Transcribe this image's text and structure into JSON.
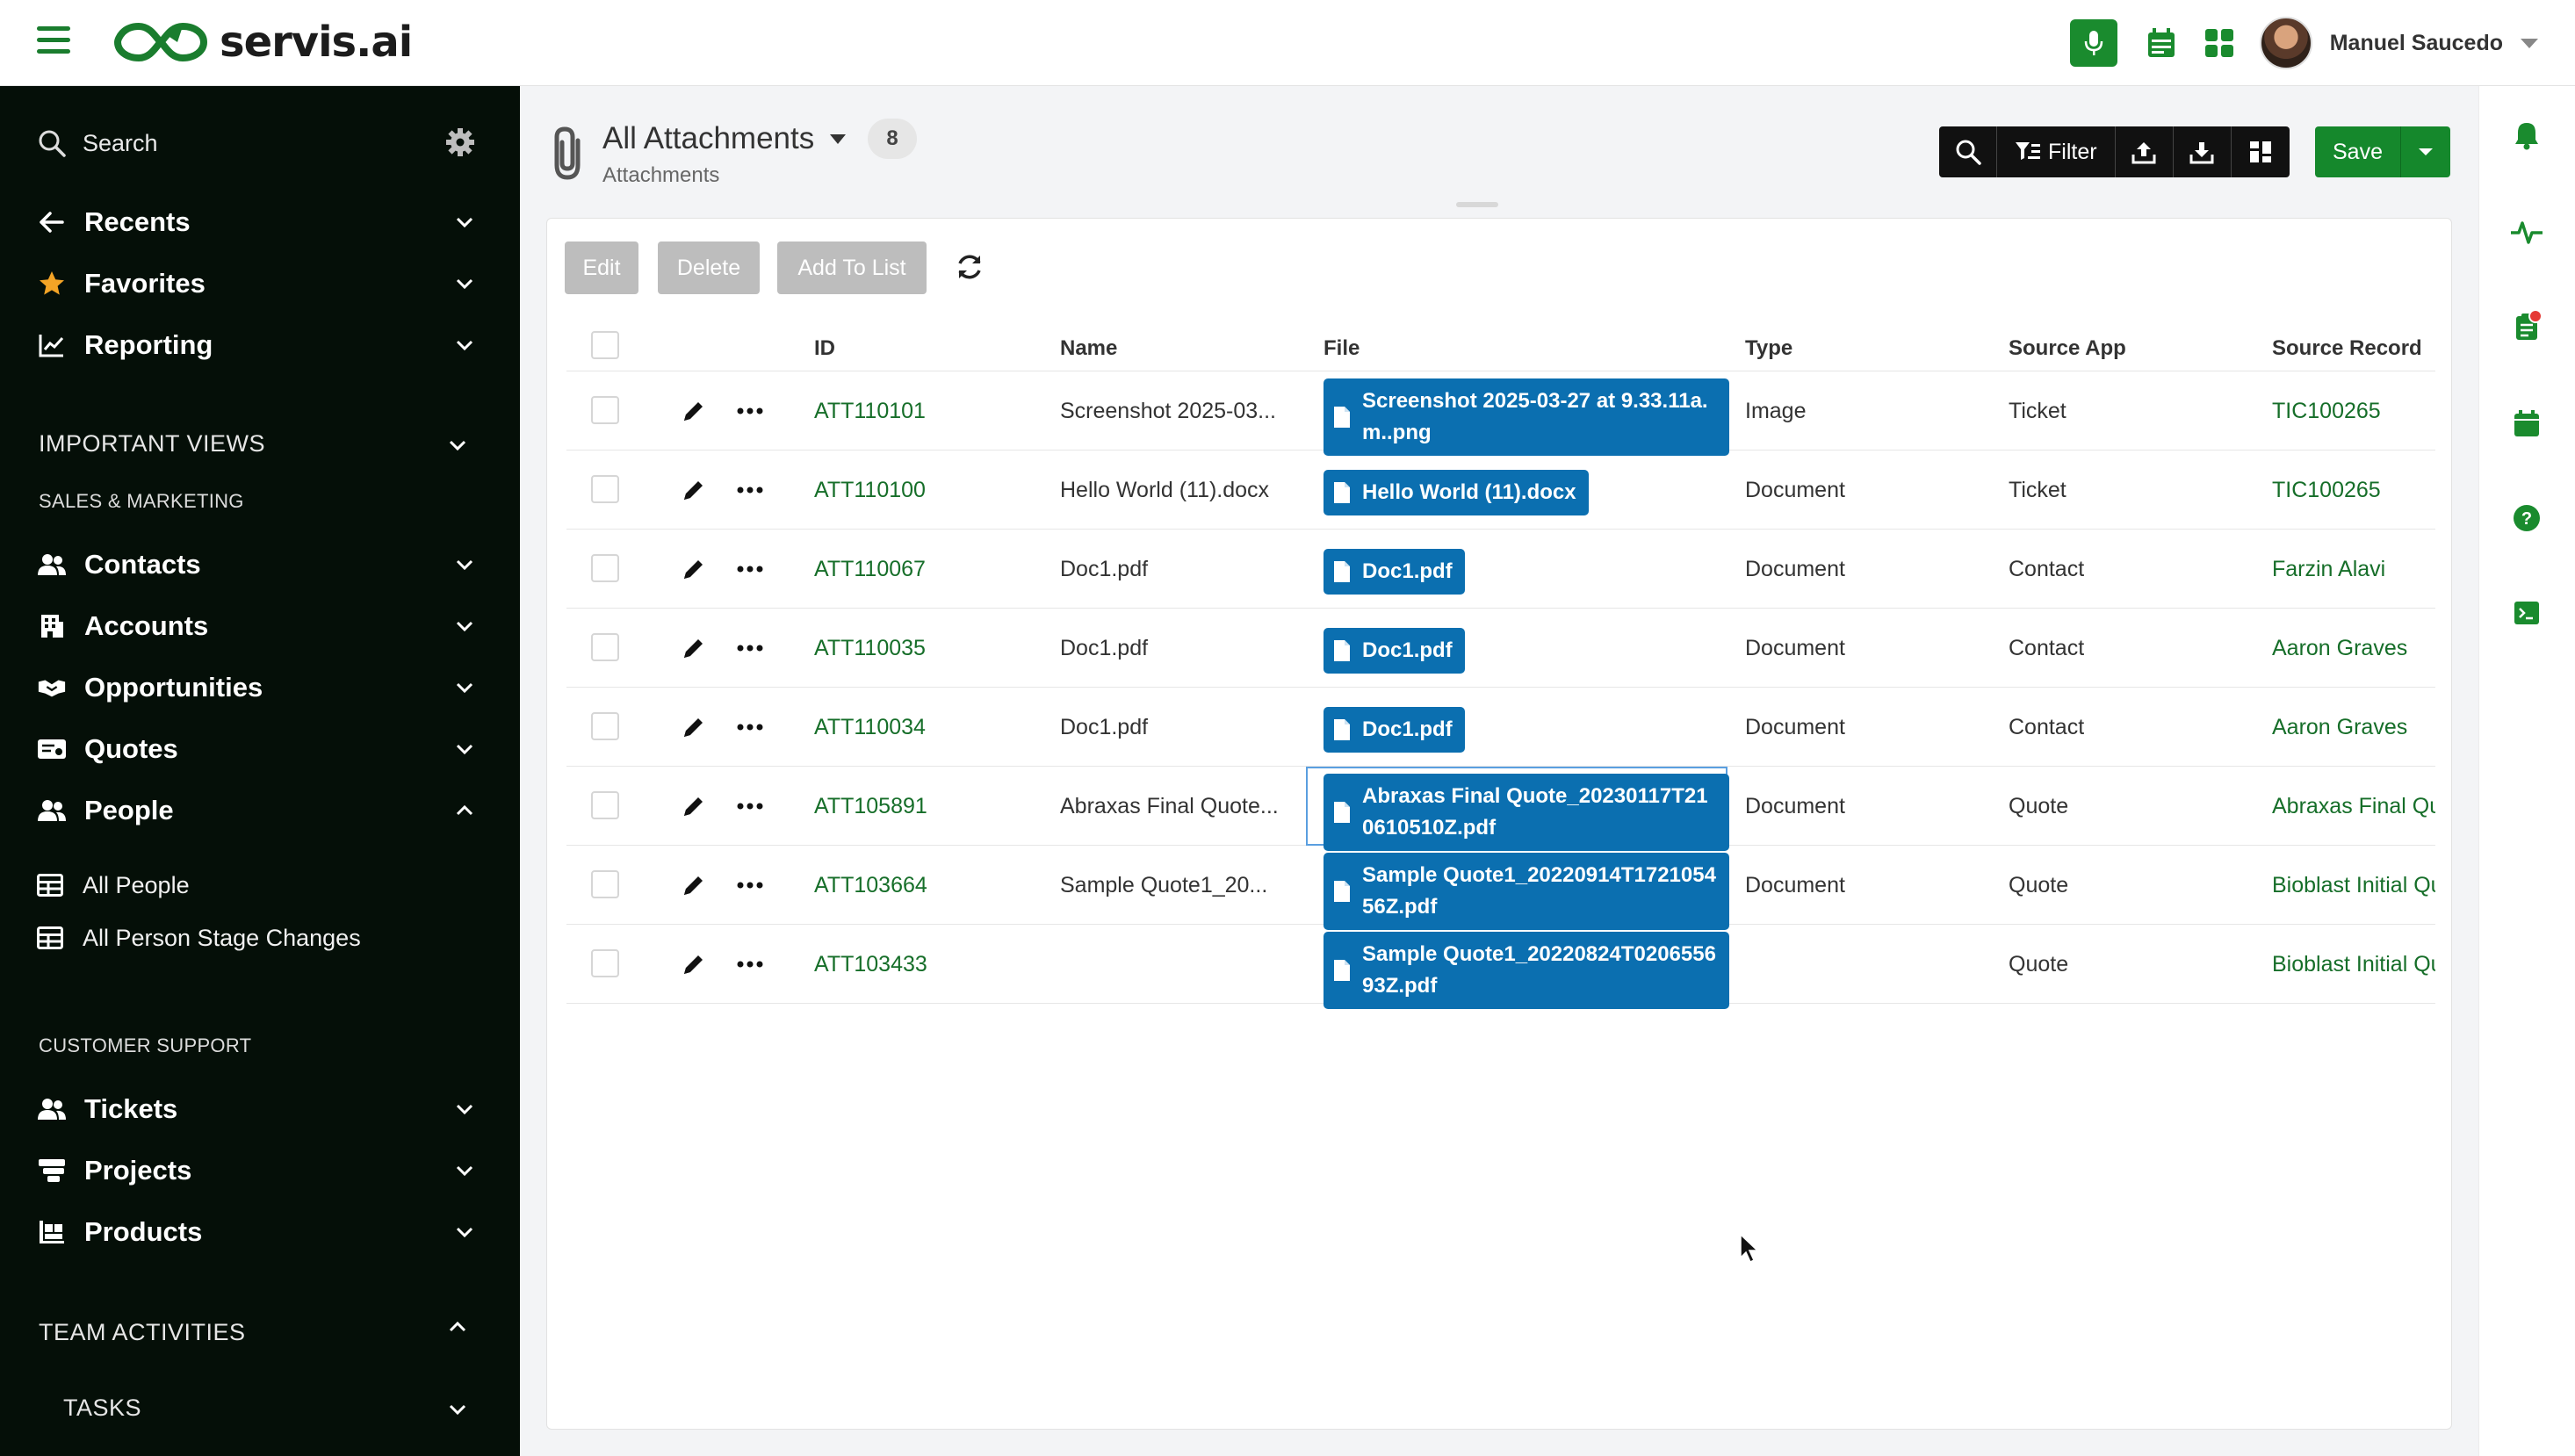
{
  "header": {
    "brand": "servis.ai",
    "user_name": "Manuel Saucedo"
  },
  "sidebar": {
    "search_label": "Search",
    "top_items": [
      {
        "label": "Recents",
        "icon": "arrow-left-icon"
      },
      {
        "label": "Favorites",
        "icon": "star-icon"
      },
      {
        "label": "Reporting",
        "icon": "line-chart-icon"
      }
    ],
    "important_views": "IMPORTANT VIEWS",
    "sales_marketing": "SALES & MARKETING",
    "sales_items": [
      {
        "label": "Contacts",
        "icon": "users-icon"
      },
      {
        "label": "Accounts",
        "icon": "building-icon"
      },
      {
        "label": "Opportunities",
        "icon": "handshake-icon"
      },
      {
        "label": "Quotes",
        "icon": "quote-icon"
      },
      {
        "label": "People",
        "icon": "users-icon"
      }
    ],
    "people_children": [
      "All People",
      "All Person Stage Changes"
    ],
    "customer_support": "CUSTOMER SUPPORT",
    "support_items": [
      {
        "label": "Tickets",
        "icon": "users-icon"
      },
      {
        "label": "Projects",
        "icon": "projects-icon"
      },
      {
        "label": "Products",
        "icon": "products-icon"
      }
    ],
    "team_activities": "TEAM ACTIVITIES",
    "tasks": "TASKS"
  },
  "view": {
    "title": "All Attachments",
    "count": "8",
    "subtitle": "Attachments",
    "filter_label": "Filter",
    "save_label": "Save",
    "actions": [
      "Edit",
      "Delete",
      "Add To List"
    ]
  },
  "table": {
    "columns": [
      "ID",
      "Name",
      "File",
      "Type",
      "Source App",
      "Source Record"
    ],
    "rows": [
      {
        "id": "ATT110101",
        "name": "Screenshot 2025-03...",
        "file": "Screenshot 2025-03-27 at 9.33.11a.m..png",
        "type": "Image",
        "app": "Ticket",
        "record": "TIC100265"
      },
      {
        "id": "ATT110100",
        "name": "Hello World (11).docx",
        "file": "Hello World (11).docx",
        "type": "Document",
        "app": "Ticket",
        "record": "TIC100265"
      },
      {
        "id": "ATT110067",
        "name": "Doc1.pdf",
        "file": "Doc1.pdf",
        "type": "Document",
        "app": "Contact",
        "record": "Farzin Alavi"
      },
      {
        "id": "ATT110035",
        "name": "Doc1.pdf",
        "file": "Doc1.pdf",
        "type": "Document",
        "app": "Contact",
        "record": "Aaron Graves"
      },
      {
        "id": "ATT110034",
        "name": "Doc1.pdf",
        "file": "Doc1.pdf",
        "type": "Document",
        "app": "Contact",
        "record": "Aaron Graves"
      },
      {
        "id": "ATT105891",
        "name": "Abraxas Final Quote...",
        "file": "Abraxas Final Quote_20230117T210610510Z.pdf",
        "type": "Document",
        "app": "Quote",
        "record": "Abraxas Final Quo"
      },
      {
        "id": "ATT103664",
        "name": "Sample Quote1_20...",
        "file": "Sample Quote1_20220914T172105456Z.pdf",
        "type": "Document",
        "app": "Quote",
        "record": "Bioblast Initial Quo"
      },
      {
        "id": "ATT103433",
        "name": "",
        "file": "Sample Quote1_20220824T020655693Z.pdf",
        "type": "",
        "app": "Quote",
        "record": "Bioblast Initial Quo"
      }
    ]
  },
  "colors": {
    "brand_green": "#15882c",
    "link_green": "#166e29",
    "chip_blue": "#0b6fb0",
    "sidebar_bg": "#050f08"
  }
}
